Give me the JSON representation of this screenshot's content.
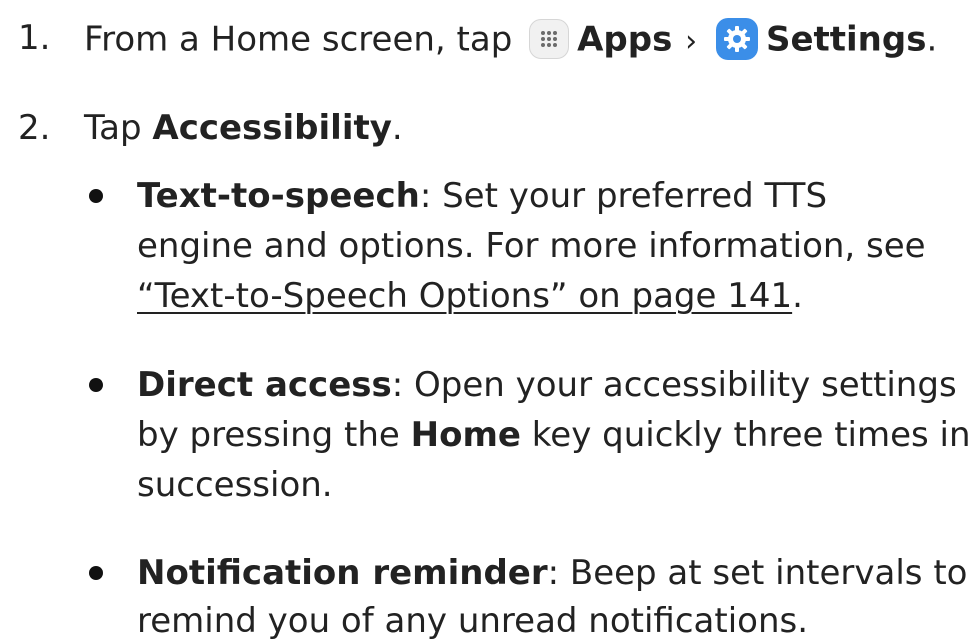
{
  "steps": [
    {
      "number": "1.",
      "intro": "From a Home screen, tap",
      "apps_label": "Apps",
      "separator": "›",
      "settings_label": "Settings",
      "end": "."
    },
    {
      "number": "2.",
      "intro": "Tap",
      "target": "Accessibility",
      "end": "."
    }
  ],
  "bullets": [
    {
      "term": "Text-to-speech",
      "line1": ": Set your preferred TTS",
      "line2": "engine and options. For more information, see",
      "link": "“Text-to-Speech Options” on page 141",
      "link_end": "."
    },
    {
      "term": "Direct access",
      "line1": ": Open your accessibility settings",
      "line2_pre": "by pressing the",
      "line2_bold": "Home",
      "line2_post": "key quickly three times in",
      "line3": "succession."
    },
    {
      "term": "Notification reminder",
      "line1": ": Beep at set intervals to",
      "line2": "remind you of any unread notifications."
    }
  ],
  "icons": {
    "apps": "apps-grid-icon",
    "settings": "settings-gear-icon",
    "settings_color": "#3b8ee8"
  }
}
